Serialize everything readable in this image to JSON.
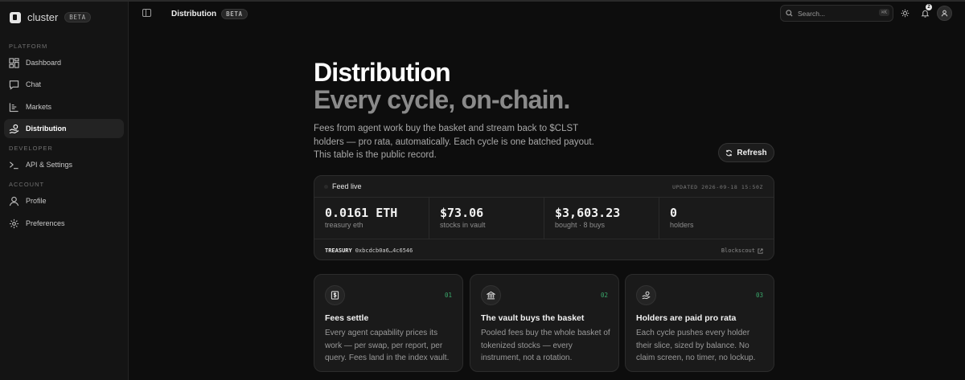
{
  "app": {
    "name": "cluster",
    "badge": "BETA"
  },
  "sidebar": {
    "sections": [
      {
        "label": "PLATFORM"
      },
      {
        "label": "DEVELOPER"
      },
      {
        "label": "ACCOUNT"
      }
    ],
    "items": [
      {
        "label": "Dashboard",
        "icon": "dashboard-icon"
      },
      {
        "label": "Chat",
        "icon": "chat-icon"
      },
      {
        "label": "Markets",
        "icon": "markets-icon"
      },
      {
        "label": "Distribution",
        "icon": "distribution-icon",
        "active": true
      },
      {
        "label": "API & Settings",
        "icon": "terminal-icon"
      },
      {
        "label": "Profile",
        "icon": "user-icon"
      },
      {
        "label": "Preferences",
        "icon": "gear-icon"
      }
    ]
  },
  "header": {
    "title": "Distribution",
    "badge": "BETA",
    "search_placeholder": "Search...",
    "search_shortcut": "⌘K",
    "notification_count": "2"
  },
  "hero": {
    "title": "Distribution",
    "subtitle": "Every cycle, on-chain.",
    "description": "Fees from agent work buy the basket and stream back to $CLST holders — pro rata, automatically. Each cycle is one batched payout. This table is the public record.",
    "refresh_label": "Refresh"
  },
  "feed": {
    "status": "Feed live",
    "updated": "UPDATED 2026-09-18 15:50Z",
    "stats": [
      {
        "value": "0.0161 ETH",
        "label": "treasury eth"
      },
      {
        "value": "$73.06",
        "label": "stocks in vault"
      },
      {
        "value": "$3,603.23",
        "label": "bought · 8 buys"
      },
      {
        "value": "0",
        "label": "holders"
      }
    ],
    "treasury_label": "TREASURY",
    "treasury_address": "0xbcdcb0a6…4c6546",
    "explorer_label": "Blockscout"
  },
  "cards": [
    {
      "num": "01",
      "title": "Fees settle",
      "body": "Every agent capability prices its work — per swap, per report, per query. Fees land in the index vault.",
      "icon": "dollar-icon"
    },
    {
      "num": "02",
      "title": "The vault buys the basket",
      "body": "Pooled fees buy the whole basket of tokenized stocks — every instrument, not a rotation.",
      "icon": "bank-icon"
    },
    {
      "num": "03",
      "title": "Holders are paid pro rata",
      "body": "Each cycle pushes every holder their slice, sized by balance. No claim screen, no timer, no lockup.",
      "icon": "hand-coins-icon"
    }
  ],
  "colors": {
    "accent_green": "#3aa86b",
    "background": "#0d0d0d",
    "panel": "#1a1a1a"
  }
}
